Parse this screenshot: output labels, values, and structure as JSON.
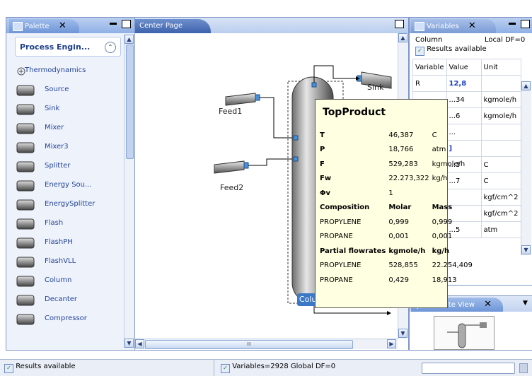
{
  "palette": {
    "tab_label": "Palette",
    "close_glyph": "✕",
    "header": "Process Engin...",
    "items": [
      {
        "label": "Thermodynamics",
        "icon": "thermodynamics-icon"
      },
      {
        "label": "Source",
        "icon": "source-icon"
      },
      {
        "label": "Sink",
        "icon": "sink-icon"
      },
      {
        "label": "Mixer",
        "icon": "mixer-icon"
      },
      {
        "label": "Mixer3",
        "icon": "mixer3-icon"
      },
      {
        "label": "Splitter",
        "icon": "splitter-icon"
      },
      {
        "label": "Energy Sou...",
        "icon": "energy-source-icon"
      },
      {
        "label": "EnergySplitter",
        "icon": "energy-splitter-icon"
      },
      {
        "label": "Flash",
        "icon": "flash-icon"
      },
      {
        "label": "FlashPH",
        "icon": "flashph-icon"
      },
      {
        "label": "FlashVLL",
        "icon": "flashvll-icon"
      },
      {
        "label": "Column",
        "icon": "column-icon"
      },
      {
        "label": "Decanter",
        "icon": "decanter-icon"
      },
      {
        "label": "Compressor",
        "icon": "compressor-icon"
      }
    ]
  },
  "center": {
    "tab_label": "Center Page",
    "labels": {
      "feed1": "Feed1",
      "feed2": "Feed2",
      "sink": "Sink",
      "column": "Column"
    },
    "hscroll_grip": "III"
  },
  "tooltip": {
    "title": "TopProduct",
    "rows": [
      {
        "c1": "T",
        "c2": "46,387",
        "c3": "C",
        "bold": false,
        "label_bold": true
      },
      {
        "c1": "P",
        "c2": "18,766",
        "c3": "atm",
        "bold": false,
        "label_bold": true
      },
      {
        "c1": "F",
        "c2": "529,283",
        "c3": "kgmole/h",
        "bold": false,
        "label_bold": true
      },
      {
        "c1": "Fw",
        "c2": "22.273,322",
        "c3": "kg/h",
        "bold": false,
        "label_bold": true
      },
      {
        "c1": "Φv",
        "c2": "1",
        "c3": "",
        "bold": false,
        "label_bold": true
      },
      {
        "c1": "Composition",
        "c2": "Molar",
        "c3": "Mass",
        "bold": true,
        "label_bold": true
      },
      {
        "c1": "PROPYLENE",
        "c2": "0,999",
        "c3": "0,999",
        "bold": false,
        "label_bold": false
      },
      {
        "c1": "PROPANE",
        "c2": "0,001",
        "c3": "0,001",
        "bold": false,
        "label_bold": false
      },
      {
        "c1": "Partial flowrates",
        "c2": "kgmole/h",
        "c3": "kg/h",
        "bold": true,
        "label_bold": true
      },
      {
        "c1": "PROPYLENE",
        "c2": "528,855",
        "c3": "22.254,409",
        "bold": false,
        "label_bold": false
      },
      {
        "c1": "PROPANE",
        "c2": "0,429",
        "c3": "18,913",
        "bold": false,
        "label_bold": false
      }
    ]
  },
  "variables": {
    "tab_label": "Variables",
    "close_glyph": "✕",
    "context": "Column",
    "local_df": "Local DF=0",
    "results": "Results available",
    "headers": [
      "Variable",
      "Value",
      "Unit"
    ],
    "rows": [
      {
        "var": "R",
        "val": "12,8",
        "unit": "",
        "blue": true
      },
      {
        "var": "",
        "val": "...34",
        "unit": "kgmole/h",
        "blue": false
      },
      {
        "var": "",
        "val": "...6",
        "unit": "kgmole/h",
        "blue": false
      },
      {
        "var": "",
        "val": "...",
        "unit": "",
        "blue": false
      },
      {
        "var": "",
        "val": "]",
        "unit": "",
        "blue": true
      },
      {
        "var": "",
        "val": "...3",
        "unit": "C",
        "blue": false
      },
      {
        "var": "",
        "val": "...7",
        "unit": "C",
        "blue": false
      },
      {
        "var": "",
        "val": "",
        "unit": "kgf/cm^2",
        "blue": false
      },
      {
        "var": "",
        "val": "",
        "unit": "kgf/cm^2",
        "blue": false
      },
      {
        "var": "",
        "val": "...5",
        "unit": "atm",
        "blue": false
      }
    ]
  },
  "satellite": {
    "tab_label": "Satellite View",
    "close_glyph": "✕"
  },
  "status": {
    "left": "Results available",
    "mid": "Variables=2928 Global DF=0"
  },
  "colors": {
    "accent": "#3d62ad",
    "column_label_bg": "#3b78c6",
    "tooltip_bg": "#ffffe1"
  }
}
